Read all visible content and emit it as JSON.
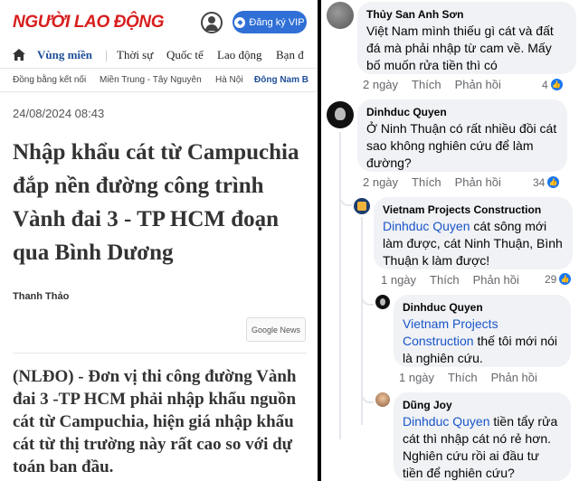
{
  "article": {
    "logo": "NGƯỜI LAO ĐỘNG",
    "register_label": "Đăng ký VIP",
    "nav": [
      "Vùng miền",
      "Thời sự",
      "Quốc tế",
      "Lao động",
      "Bạn đ"
    ],
    "subnav": [
      "Đồng bằng kết nối",
      "Miền Trung - Tây Nguyên",
      "Hà Nội",
      "Đông Nam B"
    ],
    "date": "24/08/2024 08:43",
    "headline": "Nhập khẩu cát từ Campuchia đắp nền đường công trình Vành đai 3 - TP HCM đoạn qua Bình Dương",
    "author": "Thanh Thảo",
    "google_news_label": "Google News",
    "lead": "(NLĐO) - Đơn vị thi công đường Vành đai 3 -TP HCM phải nhập khẩu nguồn cát từ Campuchia, hiện giá nhập khẩu cát từ thị trường này rất cao so với dự toán ban đầu."
  },
  "comments": [
    {
      "name": "Thủy San Anh Sơn",
      "text": "Việt Nam mình thiếu gì cát và đất đá mà phải nhập từ cam về. Mấy bố muốn rửa tiền thì có",
      "time": "2 ngày",
      "like": "Thích",
      "reply": "Phản hồi",
      "reactions": "4"
    },
    {
      "name": "Dinhduc Quyen",
      "text": "Ở Ninh Thuận có rất nhiều đồi cát sao không nghiên cứu để làm đường?",
      "time": "2 ngày",
      "like": "Thích",
      "reply": "Phản hồi",
      "reactions": "34"
    },
    {
      "name": "Vietnam Projects Construction",
      "mention": "Dinhduc Quyen",
      "text": " cát sông mới làm được, cát Ninh Thuận, Bình Thuận k làm được!",
      "time": "1 ngày",
      "like": "Thích",
      "reply": "Phản hồi",
      "reactions": "29"
    },
    {
      "name": "Dinhduc Quyen",
      "mention": "Vietnam Projects Construction",
      "text": " thế tôi mới nói là nghiên cứu.",
      "time": "1 ngày",
      "like": "Thích",
      "reply": "Phản hồi"
    },
    {
      "name": "Dũng Joy",
      "mention": "Dinhduc Quyen",
      "text": " tiền tẩy rửa cát thì nhập cát nó rẻ hơn. Nghiên cứu rồi ai đầu tư tiền để nghiên cứu?"
    }
  ],
  "colors": {
    "brand_red": "#d81e1e",
    "vip_blue": "#2f6fd6",
    "mention_blue": "#1a55c9",
    "bubble": "#f0f2f5"
  }
}
